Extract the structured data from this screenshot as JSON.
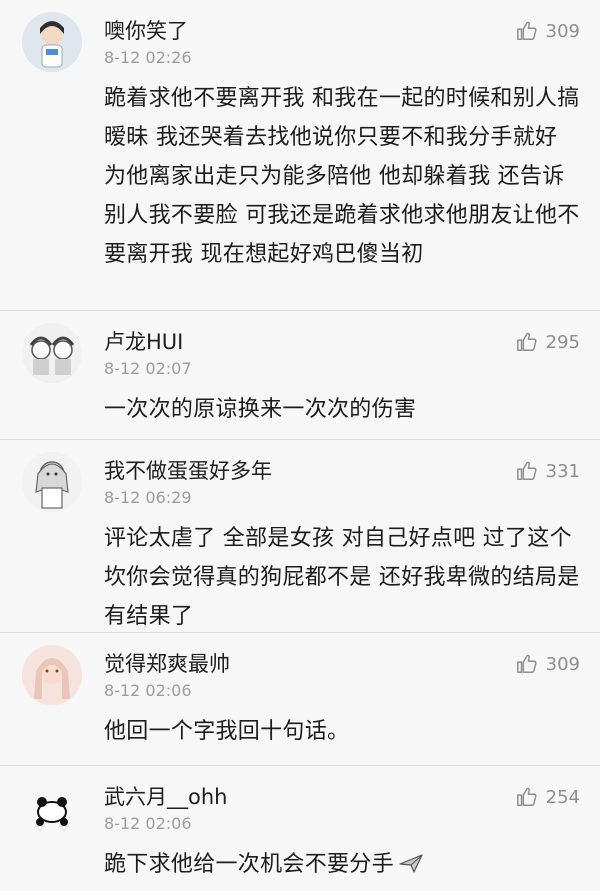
{
  "comments": [
    {
      "username": "噢你笑了",
      "time": "8-12 02:26",
      "likes": "309",
      "text": "跪着求他不要离开我 和我在一起的时候和别人搞暧昧 我还哭着去找他说你只要不和我分手就好 为他离家出走只为能多陪他 他却躲着我 还告诉别人我不要脸 可我还是跪着求他求他朋友让他不要离开我 现在想起好鸡巴傻当初"
    },
    {
      "username": "卢龙HUI",
      "time": "8-12 02:07",
      "likes": "295",
      "text": "一次次的原谅换来一次次的伤害"
    },
    {
      "username": "我不做蛋蛋好多年",
      "time": "8-12 06:29",
      "likes": "331",
      "text": "评论太虐了 全部是女孩 对自己好点吧 过了这个坎你会觉得真的狗屁都不是 还好我卑微的结局是有结果了"
    },
    {
      "username": "觉得郑爽最帅",
      "time": "8-12 02:06",
      "likes": "309",
      "text": "他回一个字我回十句话。"
    },
    {
      "username": "武六月__ohh",
      "time": "8-12 02:06",
      "likes": "254",
      "text": "跪下求他给一次机会不要分手"
    }
  ],
  "icons": {
    "like": "thumbs-up-icon",
    "emoji": "airplane-emoji-icon"
  },
  "colors": {
    "background": "#f7f7f7",
    "divider": "#dcdcdc",
    "meta": "#9c9c9c"
  }
}
